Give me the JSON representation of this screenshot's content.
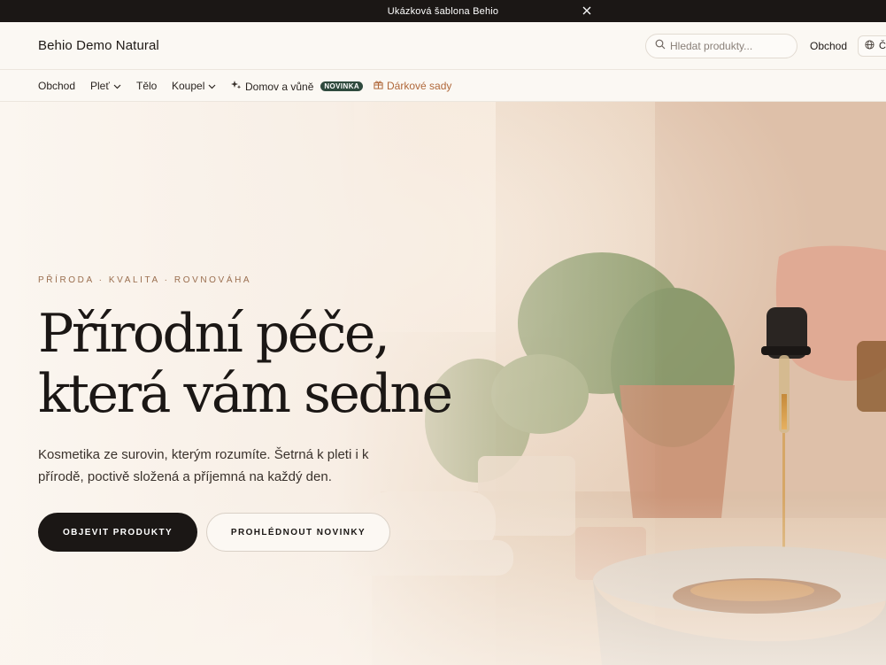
{
  "announcement": {
    "text": "Ukázková šablona Behio"
  },
  "header": {
    "logo": "Behio Demo Natural",
    "search_placeholder": "Hledat produkty...",
    "shop_link": "Obchod",
    "lang_label": "Č"
  },
  "nav": {
    "items": [
      {
        "label": "Obchod"
      },
      {
        "label": "Pleť"
      },
      {
        "label": "Tělo"
      },
      {
        "label": "Koupel"
      },
      {
        "label": "Domov a vůně",
        "badge": "NOVINKA"
      },
      {
        "label": "Dárkové sady"
      }
    ]
  },
  "hero": {
    "eyebrow": "PŘÍRODA · KVALITA · ROVNOVÁHA",
    "headline_line1": "Přírodní péče,",
    "headline_line2": "která vám sedne",
    "subtext": "Kosmetika ze surovin, kterým rozumíte. Šetrná k pleti i k přírodě, poctivě složená a příjemná na každý den.",
    "cta_primary": "OBJEVIT PRODUKTY",
    "cta_secondary": "PROHLÉDNOUT NOVINKY"
  },
  "colors": {
    "dark": "#1b1715",
    "accent_gift": "#b0683a",
    "badge_green": "#2f4a3e",
    "eyebrow": "#9a6e4f"
  }
}
